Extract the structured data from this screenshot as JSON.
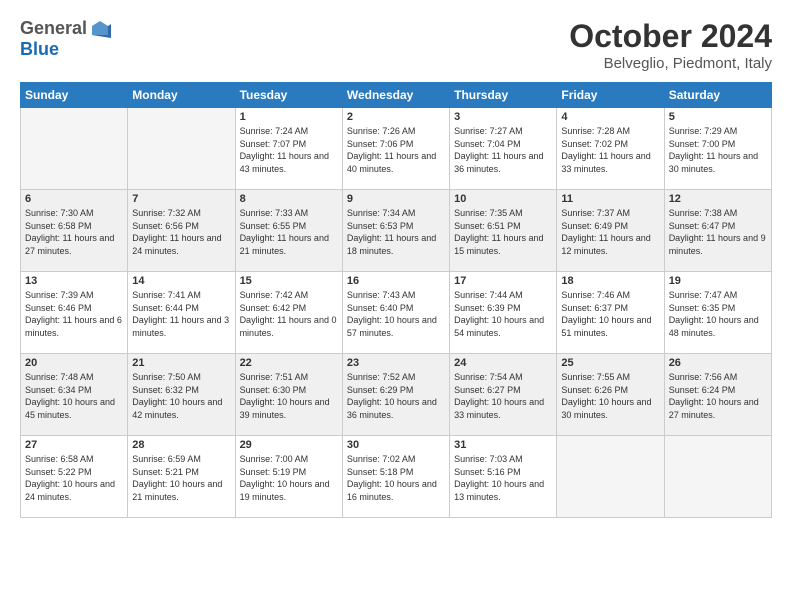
{
  "header": {
    "logo_line1": "General",
    "logo_line2": "Blue",
    "title": "October 2024",
    "location": "Belveglio, Piedmont, Italy"
  },
  "weekdays": [
    "Sunday",
    "Monday",
    "Tuesday",
    "Wednesday",
    "Thursday",
    "Friday",
    "Saturday"
  ],
  "days": {
    "1": {
      "sunrise": "7:24 AM",
      "sunset": "7:07 PM",
      "daylight": "Daylight: 11 hours and 43 minutes."
    },
    "2": {
      "sunrise": "7:26 AM",
      "sunset": "7:06 PM",
      "daylight": "Daylight: 11 hours and 40 minutes."
    },
    "3": {
      "sunrise": "7:27 AM",
      "sunset": "7:04 PM",
      "daylight": "Daylight: 11 hours and 36 minutes."
    },
    "4": {
      "sunrise": "7:28 AM",
      "sunset": "7:02 PM",
      "daylight": "Daylight: 11 hours and 33 minutes."
    },
    "5": {
      "sunrise": "7:29 AM",
      "sunset": "7:00 PM",
      "daylight": "Daylight: 11 hours and 30 minutes."
    },
    "6": {
      "sunrise": "7:30 AM",
      "sunset": "6:58 PM",
      "daylight": "Daylight: 11 hours and 27 minutes."
    },
    "7": {
      "sunrise": "7:32 AM",
      "sunset": "6:56 PM",
      "daylight": "Daylight: 11 hours and 24 minutes."
    },
    "8": {
      "sunrise": "7:33 AM",
      "sunset": "6:55 PM",
      "daylight": "Daylight: 11 hours and 21 minutes."
    },
    "9": {
      "sunrise": "7:34 AM",
      "sunset": "6:53 PM",
      "daylight": "Daylight: 11 hours and 18 minutes."
    },
    "10": {
      "sunrise": "7:35 AM",
      "sunset": "6:51 PM",
      "daylight": "Daylight: 11 hours and 15 minutes."
    },
    "11": {
      "sunrise": "7:37 AM",
      "sunset": "6:49 PM",
      "daylight": "Daylight: 11 hours and 12 minutes."
    },
    "12": {
      "sunrise": "7:38 AM",
      "sunset": "6:47 PM",
      "daylight": "Daylight: 11 hours and 9 minutes."
    },
    "13": {
      "sunrise": "7:39 AM",
      "sunset": "6:46 PM",
      "daylight": "Daylight: 11 hours and 6 minutes."
    },
    "14": {
      "sunrise": "7:41 AM",
      "sunset": "6:44 PM",
      "daylight": "Daylight: 11 hours and 3 minutes."
    },
    "15": {
      "sunrise": "7:42 AM",
      "sunset": "6:42 PM",
      "daylight": "Daylight: 11 hours and 0 minutes."
    },
    "16": {
      "sunrise": "7:43 AM",
      "sunset": "6:40 PM",
      "daylight": "Daylight: 10 hours and 57 minutes."
    },
    "17": {
      "sunrise": "7:44 AM",
      "sunset": "6:39 PM",
      "daylight": "Daylight: 10 hours and 54 minutes."
    },
    "18": {
      "sunrise": "7:46 AM",
      "sunset": "6:37 PM",
      "daylight": "Daylight: 10 hours and 51 minutes."
    },
    "19": {
      "sunrise": "7:47 AM",
      "sunset": "6:35 PM",
      "daylight": "Daylight: 10 hours and 48 minutes."
    },
    "20": {
      "sunrise": "7:48 AM",
      "sunset": "6:34 PM",
      "daylight": "Daylight: 10 hours and 45 minutes."
    },
    "21": {
      "sunrise": "7:50 AM",
      "sunset": "6:32 PM",
      "daylight": "Daylight: 10 hours and 42 minutes."
    },
    "22": {
      "sunrise": "7:51 AM",
      "sunset": "6:30 PM",
      "daylight": "Daylight: 10 hours and 39 minutes."
    },
    "23": {
      "sunrise": "7:52 AM",
      "sunset": "6:29 PM",
      "daylight": "Daylight: 10 hours and 36 minutes."
    },
    "24": {
      "sunrise": "7:54 AM",
      "sunset": "6:27 PM",
      "daylight": "Daylight: 10 hours and 33 minutes."
    },
    "25": {
      "sunrise": "7:55 AM",
      "sunset": "6:26 PM",
      "daylight": "Daylight: 10 hours and 30 minutes."
    },
    "26": {
      "sunrise": "7:56 AM",
      "sunset": "6:24 PM",
      "daylight": "Daylight: 10 hours and 27 minutes."
    },
    "27": {
      "sunrise": "6:58 AM",
      "sunset": "5:22 PM",
      "daylight": "Daylight: 10 hours and 24 minutes."
    },
    "28": {
      "sunrise": "6:59 AM",
      "sunset": "5:21 PM",
      "daylight": "Daylight: 10 hours and 21 minutes."
    },
    "29": {
      "sunrise": "7:00 AM",
      "sunset": "5:19 PM",
      "daylight": "Daylight: 10 hours and 19 minutes."
    },
    "30": {
      "sunrise": "7:02 AM",
      "sunset": "5:18 PM",
      "daylight": "Daylight: 10 hours and 16 minutes."
    },
    "31": {
      "sunrise": "7:03 AM",
      "sunset": "5:16 PM",
      "daylight": "Daylight: 10 hours and 13 minutes."
    }
  }
}
